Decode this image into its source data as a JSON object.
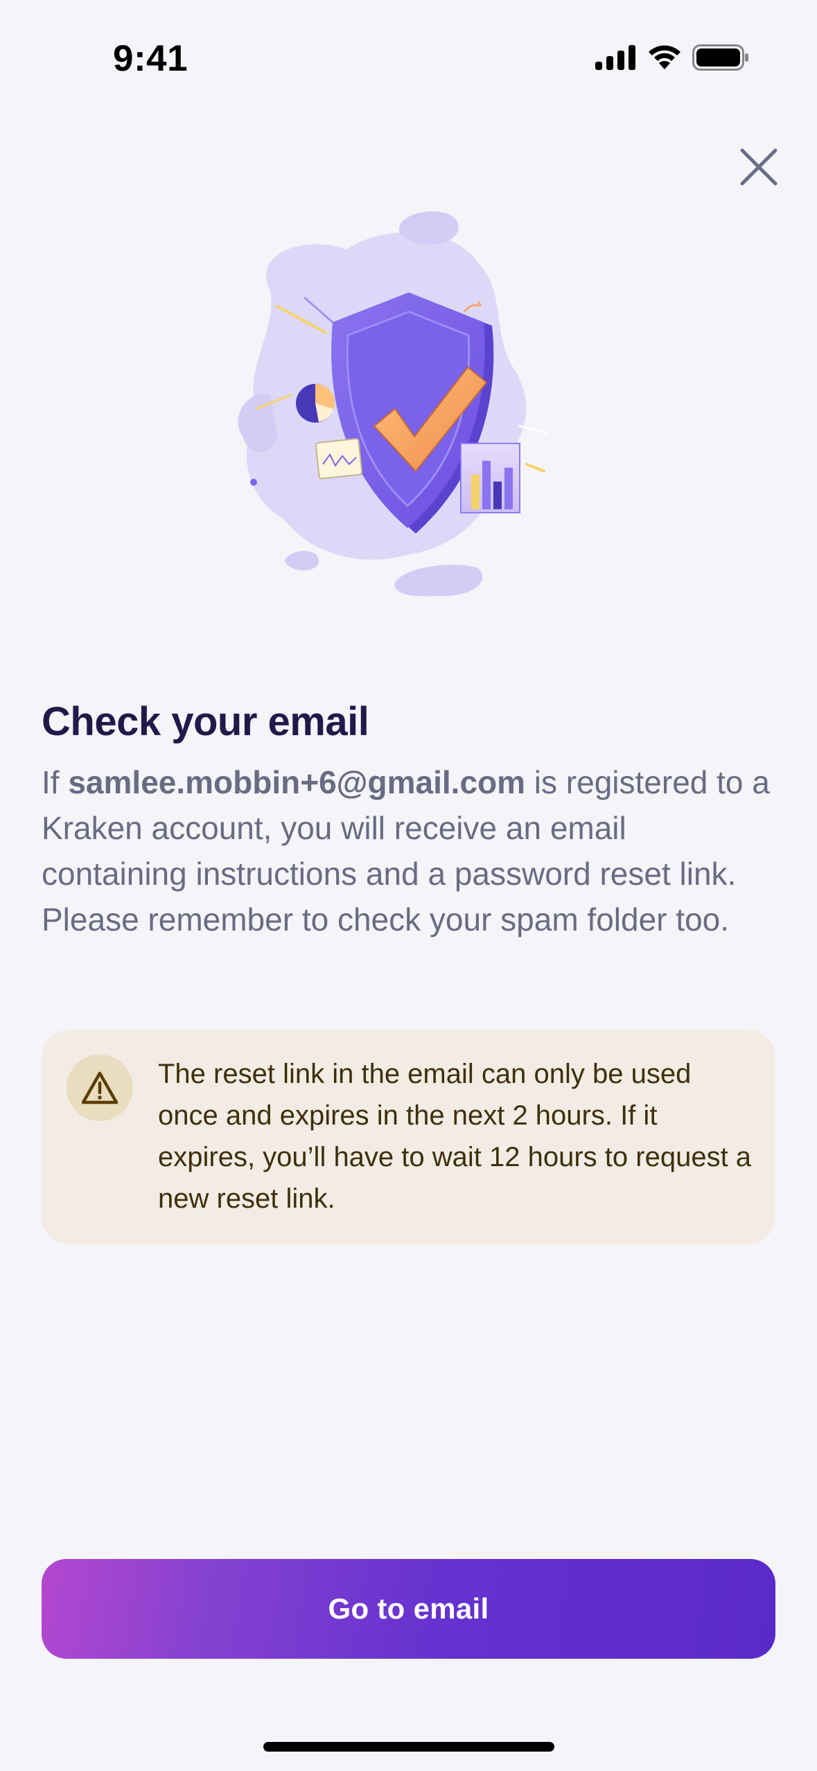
{
  "status_bar": {
    "time": "9:41",
    "icons": [
      "cellular-signal-icon",
      "wifi-icon",
      "battery-icon"
    ]
  },
  "header": {
    "close_icon": "close-icon"
  },
  "content": {
    "title": "Check your email",
    "body_prefix": "If ",
    "email": "samlee.mobbin+6@gmail.com",
    "body_suffix": " is registered to a Kraken account, you will receive an email containing instructions and a password reset link. Please remember to check your spam folder too."
  },
  "warning": {
    "icon": "warning-triangle-icon",
    "text": "The reset link in the email can only be used once and expires in the next 2 hours. If it expires, you’ll have to wait 12 hours to request a new reset link."
  },
  "actions": {
    "go_to_email_label": "Go to email"
  },
  "colors": {
    "background": "#f4f4f9",
    "title": "#22194a",
    "body": "#686b82",
    "warning_bg": "#f2ece5",
    "warning_text": "#3f2f0a",
    "button_start": "#b447cf",
    "button_end": "#5a2ac9"
  }
}
